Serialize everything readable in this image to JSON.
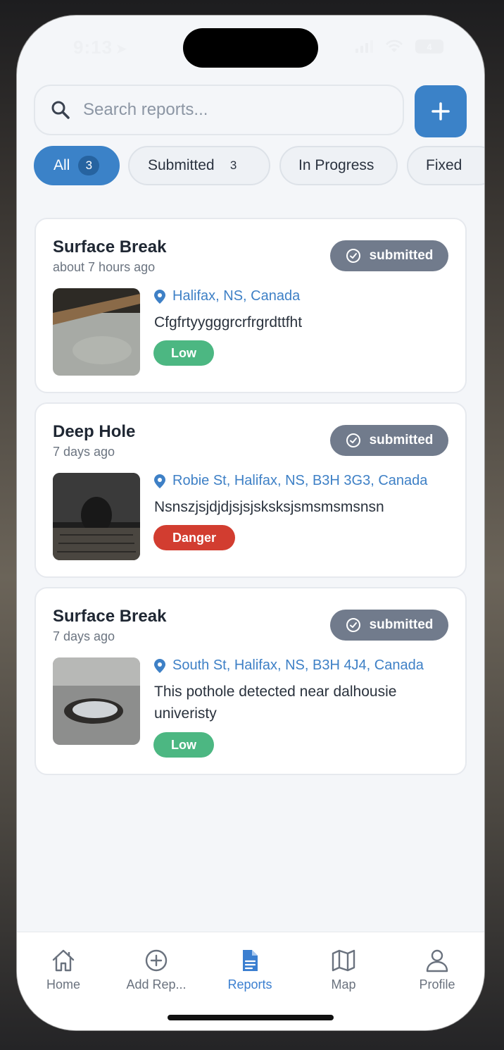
{
  "status_bar": {
    "time": "9:13",
    "battery": "4"
  },
  "search": {
    "placeholder": "Search reports..."
  },
  "filters": [
    {
      "label": "All",
      "count": "3"
    },
    {
      "label": "Submitted",
      "count": "3"
    },
    {
      "label": "In Progress"
    },
    {
      "label": "Fixed"
    }
  ],
  "reports": [
    {
      "title": "Surface Break",
      "time": "about 7 hours ago",
      "status": "submitted",
      "location": "Halifax, NS, Canada",
      "description": "Cfgfrtyygggrcrfrgrdttfht",
      "severity": "Low",
      "severity_color": "#4cb782"
    },
    {
      "title": "Deep Hole",
      "time": "7 days ago",
      "status": "submitted",
      "location": "Robie St, Halifax, NS, B3H 3G3, Canada",
      "description": "Nsnszjsjdjdjsjsjsksksjsmsmsmsnsn",
      "severity": "Danger",
      "severity_color": "#d23d30"
    },
    {
      "title": "Surface Break",
      "time": "7 days ago",
      "status": "submitted",
      "location": "South St, Halifax, NS, B3H 4J4, Canada",
      "description": "This pothole detected near dalhousie univeristy",
      "severity": "Low",
      "severity_color": "#4cb782"
    }
  ],
  "tabs": [
    {
      "label": "Home",
      "icon": "home-icon"
    },
    {
      "label": "Add Rep...",
      "icon": "plus-circle-icon"
    },
    {
      "label": "Reports",
      "icon": "document-icon"
    },
    {
      "label": "Map",
      "icon": "map-icon"
    },
    {
      "label": "Profile",
      "icon": "user-icon"
    }
  ],
  "colors": {
    "accent": "#3b82c8",
    "status_badge": "#717b8c",
    "low": "#4cb782",
    "danger": "#d23d30"
  }
}
